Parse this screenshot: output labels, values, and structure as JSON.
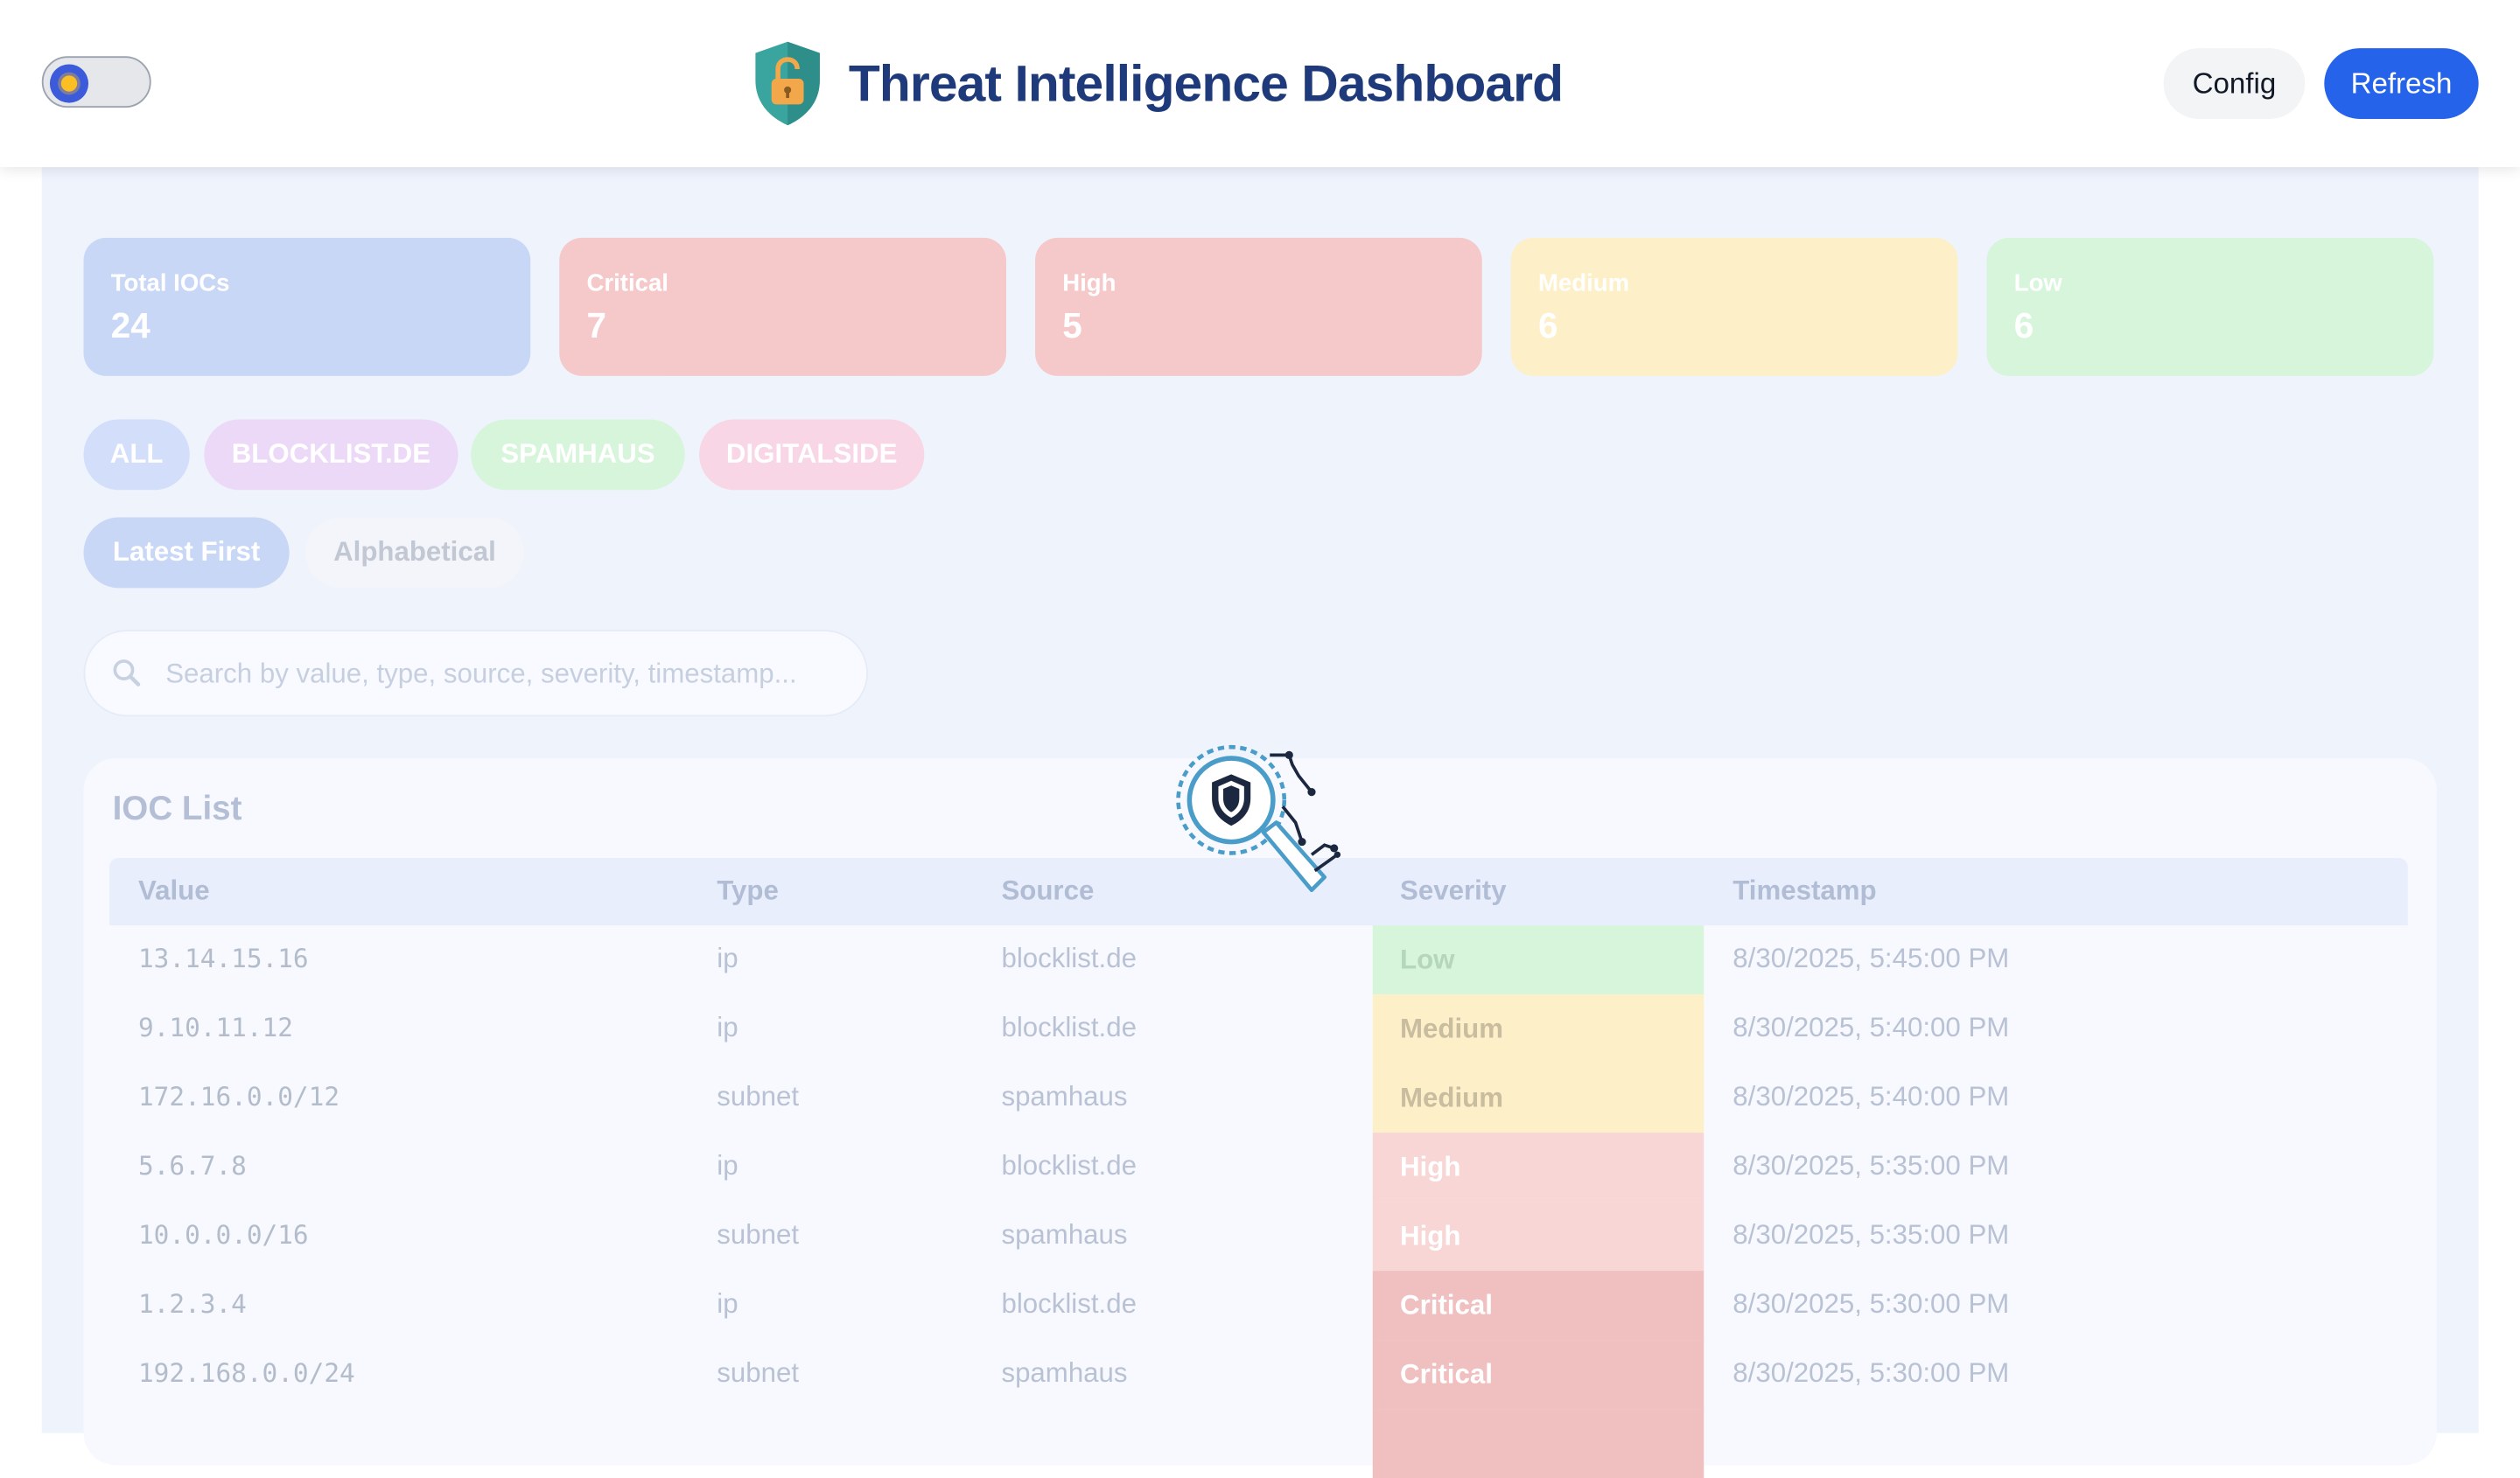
{
  "header": {
    "title": "Threat Intelligence Dashboard",
    "config_label": "Config",
    "refresh_label": "Refresh",
    "theme_icon": "sun-icon",
    "logo_icon": "shield-lock-icon"
  },
  "stats": [
    {
      "label": "Total IOCs",
      "value": "24",
      "color": "#c9d7f7"
    },
    {
      "label": "Critical",
      "value": "7",
      "color": "#f5c9c9"
    },
    {
      "label": "High",
      "value": "5",
      "color": "#f5c9c9"
    },
    {
      "label": "Medium",
      "value": "6",
      "color": "#fdf0c8"
    },
    {
      "label": "Low",
      "value": "6",
      "color": "#d6f5da"
    }
  ],
  "sources": [
    {
      "label": "ALL",
      "color": "#d3defa"
    },
    {
      "label": "BLOCKLIST.DE",
      "color": "#ecd9f7"
    },
    {
      "label": "SPAMHAUS",
      "color": "#d6f5da"
    },
    {
      "label": "DIGITALSIDE",
      "color": "#f8d6e6"
    }
  ],
  "sort": [
    {
      "label": "Latest First",
      "active": true
    },
    {
      "label": "Alphabetical",
      "active": false
    }
  ],
  "search": {
    "placeholder": "Search by value, type, source, severity, timestamp..."
  },
  "ioc_list": {
    "title": "IOC List",
    "columns": [
      "Value",
      "Type",
      "Source",
      "Severity",
      "Timestamp"
    ],
    "rows": [
      {
        "value": "13.14.15.16",
        "type": "ip",
        "source": "blocklist.de",
        "severity": "Low",
        "timestamp": "8/30/2025, 5:45:00 PM"
      },
      {
        "value": "9.10.11.12",
        "type": "ip",
        "source": "blocklist.de",
        "severity": "Medium",
        "timestamp": "8/30/2025, 5:40:00 PM"
      },
      {
        "value": "172.16.0.0/12",
        "type": "subnet",
        "source": "spamhaus",
        "severity": "Medium",
        "timestamp": "8/30/2025, 5:40:00 PM"
      },
      {
        "value": "5.6.7.8",
        "type": "ip",
        "source": "blocklist.de",
        "severity": "High",
        "timestamp": "8/30/2025, 5:35:00 PM"
      },
      {
        "value": "10.0.0.0/16",
        "type": "subnet",
        "source": "spamhaus",
        "severity": "High",
        "timestamp": "8/30/2025, 5:35:00 PM"
      },
      {
        "value": "1.2.3.4",
        "type": "ip",
        "source": "blocklist.de",
        "severity": "Critical",
        "timestamp": "8/30/2025, 5:30:00 PM"
      },
      {
        "value": "192.168.0.0/24",
        "type": "subnet",
        "source": "spamhaus",
        "severity": "Critical",
        "timestamp": "8/30/2025, 5:30:00 PM"
      }
    ]
  },
  "severity_colors": {
    "Low": {
      "bg": "#d6f5da",
      "fg": "#b5d6bb"
    },
    "Medium": {
      "bg": "#fdf0c8",
      "fg": "#c9bda0"
    },
    "High": {
      "bg": "#f8d6d6",
      "fg": "#ffffff"
    },
    "Critical": {
      "bg": "#f0c0c0",
      "fg": "#ffffff"
    }
  },
  "overlay_icon": "magnifier-shield-icon"
}
